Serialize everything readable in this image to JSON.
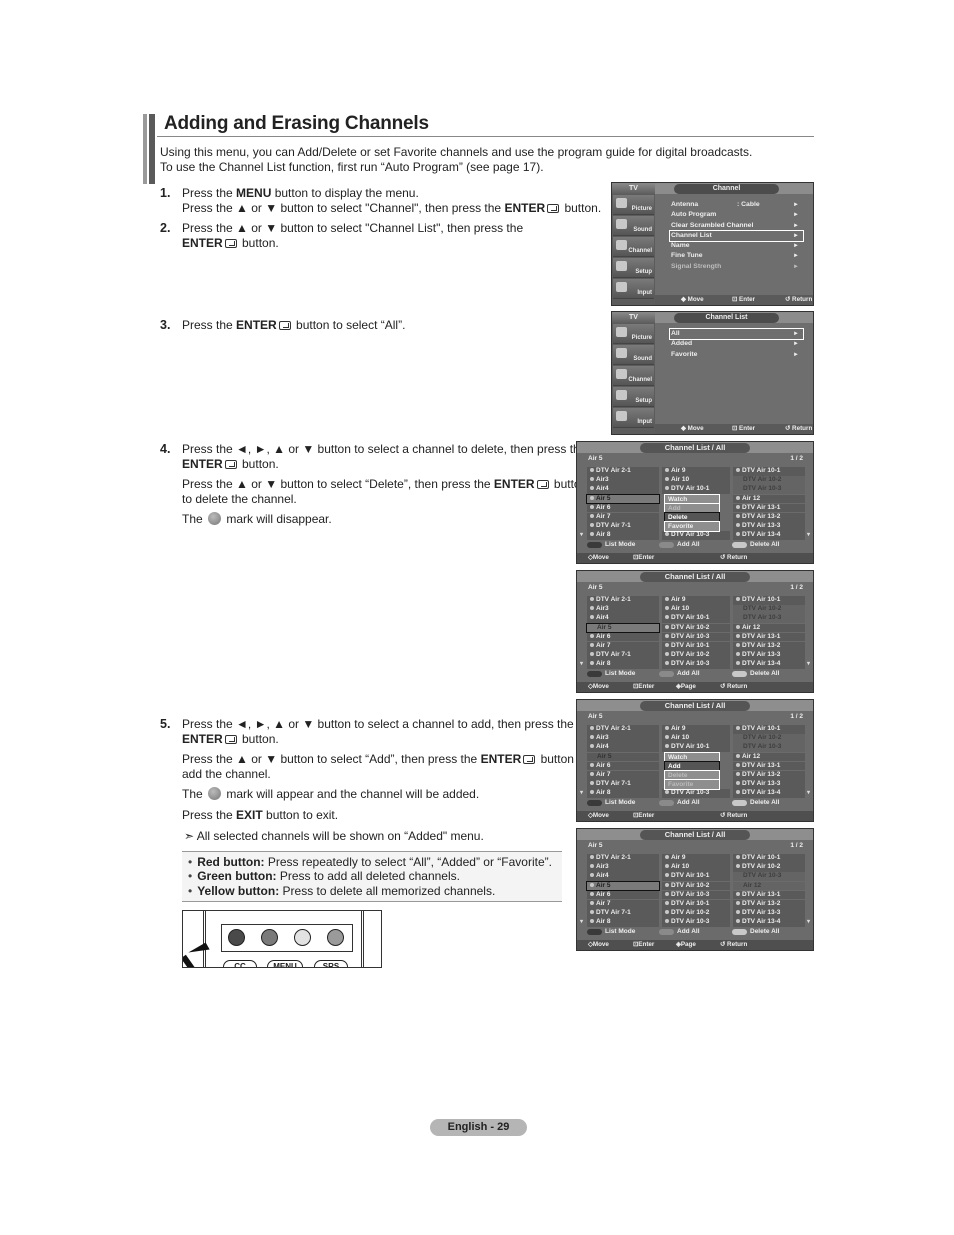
{
  "page": {
    "title": "Adding and Erasing Channels",
    "intro": [
      "Using this menu, you can Add/Delete or set Favorite channels and use the program guide for digital broadcasts.",
      "To use the Channel List function, first run “Auto Program” (see page 17)."
    ],
    "page_number": "English - 29"
  },
  "steps": [
    {
      "num": "1.",
      "lines": [
        {
          "pre": "Press the ",
          "bold": "MENU",
          "post": " button to display the menu."
        },
        {
          "pre": "Press the ▲ or ▼ button to select \"Channel\", then press the ",
          "bold": "ENTER",
          "post": " button."
        }
      ]
    },
    {
      "num": "2.",
      "line1": "Press the ▲ or ▼ button to select \"Channel List\", then press the",
      "bold": "ENTER",
      "post": " button."
    },
    {
      "num": "3.",
      "pre": "Press the ",
      "bold": "ENTER",
      "post": " button to select “All”."
    },
    {
      "num": "4.",
      "p1_line1": "Press the  ◄, ►, ▲ or ▼ button to select a channel to delete, then press the",
      "p1_bold": "ENTER",
      "p1_post": " button.",
      "p2_pre": "Press the ▲ or ▼ button to select “Delete”, then press the ",
      "p2_bold": "ENTER",
      "p2_post": " button",
      "p2_line2": "to delete the channel.",
      "p3_pre": "The ",
      "p3_post": " mark will disappear."
    },
    {
      "num": "5.",
      "p1_line1": "Press the ◄, ►, ▲ or ▼ button to select a channel to add, then press the",
      "p1_bold": "ENTER",
      "p1_post": " button.",
      "p2_pre": "Press the ▲ or ▼ button to select “Add”, then press the ",
      "p2_bold": "ENTER",
      "p2_post": " button to",
      "p2_line2": "add the channel.",
      "p3_pre": "The ",
      "p3_post": " mark will appear and the channel will be added.",
      "p4_pre": "Press the ",
      "p4_bold": "EXIT",
      "p4_post": " button to exit."
    }
  ],
  "note": "➣ All selected channels will be shown on “Added\" menu.",
  "tips": [
    {
      "label": "Red button:",
      "text": " Press repeatedly to select “All”, “Added” or “Favorite”."
    },
    {
      "label": "Green button:",
      "text": " Press to add all deleted channels."
    },
    {
      "label": "Yellow button:",
      "text": " Press to delete all memorized channels."
    }
  ],
  "remote": {
    "buttons": [
      "CC",
      "MENU",
      "SRS"
    ],
    "colors": [
      "#4a4a4a",
      "#7a7a7a",
      "#e2e2e2",
      "#9a9a9a"
    ]
  },
  "tv_sidebar": [
    "Picture",
    "Sound",
    "Channel",
    "Setup",
    "Input"
  ],
  "menu1": {
    "tv": "TV",
    "header": "Channel",
    "items": [
      {
        "label": "Antenna",
        "value": ": Cable",
        "arrow": "►"
      },
      {
        "label": "Auto Program",
        "value": "",
        "arrow": "►"
      },
      {
        "label": "Clear Scrambled Channel",
        "value": "",
        "arrow": "►"
      },
      {
        "label": "Channel List",
        "value": "",
        "arrow": "►"
      },
      {
        "label": "Name",
        "value": "",
        "arrow": "►"
      },
      {
        "label": "Fine Tune",
        "value": "",
        "arrow": "►"
      },
      {
        "label": "Signal Strength",
        "value": "",
        "arrow": "►"
      }
    ],
    "footer": [
      "◆ Move",
      "⊡ Enter",
      "↺ Return"
    ]
  },
  "menu2": {
    "tv": "TV",
    "header": "Channel List",
    "items": [
      {
        "label": "All",
        "arrow": "►"
      },
      {
        "label": "Added",
        "arrow": "►"
      },
      {
        "label": "Favorite",
        "arrow": "►"
      }
    ],
    "footer": [
      "◆ Move",
      "⊡ Enter",
      "↺ Return"
    ]
  },
  "channel_lists": [
    {
      "title": "Channel List / All",
      "current": "Air 5",
      "page": "1 / 2",
      "col1": [
        "DTV Air 2-1",
        "Air3",
        "Air4",
        "Air 5",
        "Air 6",
        "Air 7",
        "DTV Air 7-1",
        "Air 8"
      ],
      "col2": [
        "Air 9",
        "Air 10",
        "DTV Air 10-1",
        "",
        "",
        "",
        "",
        "DTV Air 10-3"
      ],
      "col3": [
        "DTV Air 10-1",
        "DTV Air 10-2",
        "DTV Air 10-3",
        "Air 12",
        "DTV Air 13-1",
        "DTV Air 13-2",
        "DTV Air 13-3",
        "DTV Air 13-4"
      ],
      "popup": [
        "Watch",
        "Add",
        "Delete",
        "Favorite"
      ],
      "buttons": [
        "List Mode",
        "Add All",
        "Delete All"
      ],
      "footer": [
        "◇Move",
        "⊡Enter",
        "↺ Return"
      ]
    },
    {
      "title": "Channel List / All",
      "current": "Air 5",
      "page": "1 / 2",
      "col1": [
        "DTV Air 2-1",
        "Air3",
        "Air4",
        "Air 5",
        "Air 6",
        "Air 7",
        "DTV Air 7-1",
        "Air 8"
      ],
      "col2": [
        "Air 9",
        "Air 10",
        "DTV Air 10-1",
        "DTV Air 10-2",
        "DTV Air 10-3",
        "DTV Air 10-1",
        "DTV Air 10-2",
        "DTV Air 10-3"
      ],
      "col3": [
        "DTV Air 10-1",
        "DTV Air 10-2",
        "DTV Air 10-3",
        "Air 12",
        "DTV Air 13-1",
        "DTV Air 13-2",
        "DTV Air 13-3",
        "DTV Air 13-4"
      ],
      "buttons": [
        "List Mode",
        "Add All",
        "Delete All"
      ],
      "footer": [
        "◇Move",
        "⊡Enter",
        "◈Page",
        "↺ Return"
      ]
    },
    {
      "title": "Channel List / All",
      "current": "Air 5",
      "page": "1 / 2",
      "col1": [
        "DTV Air 2-1",
        "Air3",
        "Air4",
        "Air 5",
        "Air 6",
        "Air 7",
        "DTV Air 7-1",
        "Air 8"
      ],
      "col2": [
        "Air 9",
        "Air 10",
        "DTV Air 10-1",
        "",
        "",
        "",
        "",
        "DTV Air 10-3"
      ],
      "col3": [
        "DTV Air 10-1",
        "DTV Air 10-2",
        "DTV Air 10-3",
        "Air 12",
        "DTV Air 13-1",
        "DTV Air 13-2",
        "DTV Air 13-3",
        "DTV Air 13-4"
      ],
      "popup": [
        "Watch",
        "Add",
        "Delete",
        "Favorite"
      ],
      "buttons": [
        "List Mode",
        "Add All",
        "Delete All"
      ],
      "footer": [
        "◇Move",
        "⊡Enter",
        "↺ Return"
      ]
    },
    {
      "title": "Channel List / All",
      "current": "Air 5",
      "page": "1 / 2",
      "col1": [
        "DTV Air 2-1",
        "Air3",
        "Air4",
        "Air 5",
        "Air 6",
        "Air 7",
        "DTV Air 7-1",
        "Air 8"
      ],
      "col2": [
        "Air 9",
        "Air 10",
        "DTV Air 10-1",
        "DTV Air 10-2",
        "DTV Air 10-3",
        "DTV Air 10-1",
        "DTV Air 10-2",
        "DTV Air 10-3"
      ],
      "col3": [
        "DTV Air 10-1",
        "DTV Air 10-2",
        "DTV Air 10-3",
        "Air 12",
        "DTV Air 13-1",
        "DTV Air 13-2",
        "DTV Air 13-3",
        "DTV Air 13-4"
      ],
      "buttons": [
        "List Mode",
        "Add All",
        "Delete All"
      ],
      "footer": [
        "◇Move",
        "⊡Enter",
        "◈Page",
        "↺ Return"
      ]
    }
  ]
}
